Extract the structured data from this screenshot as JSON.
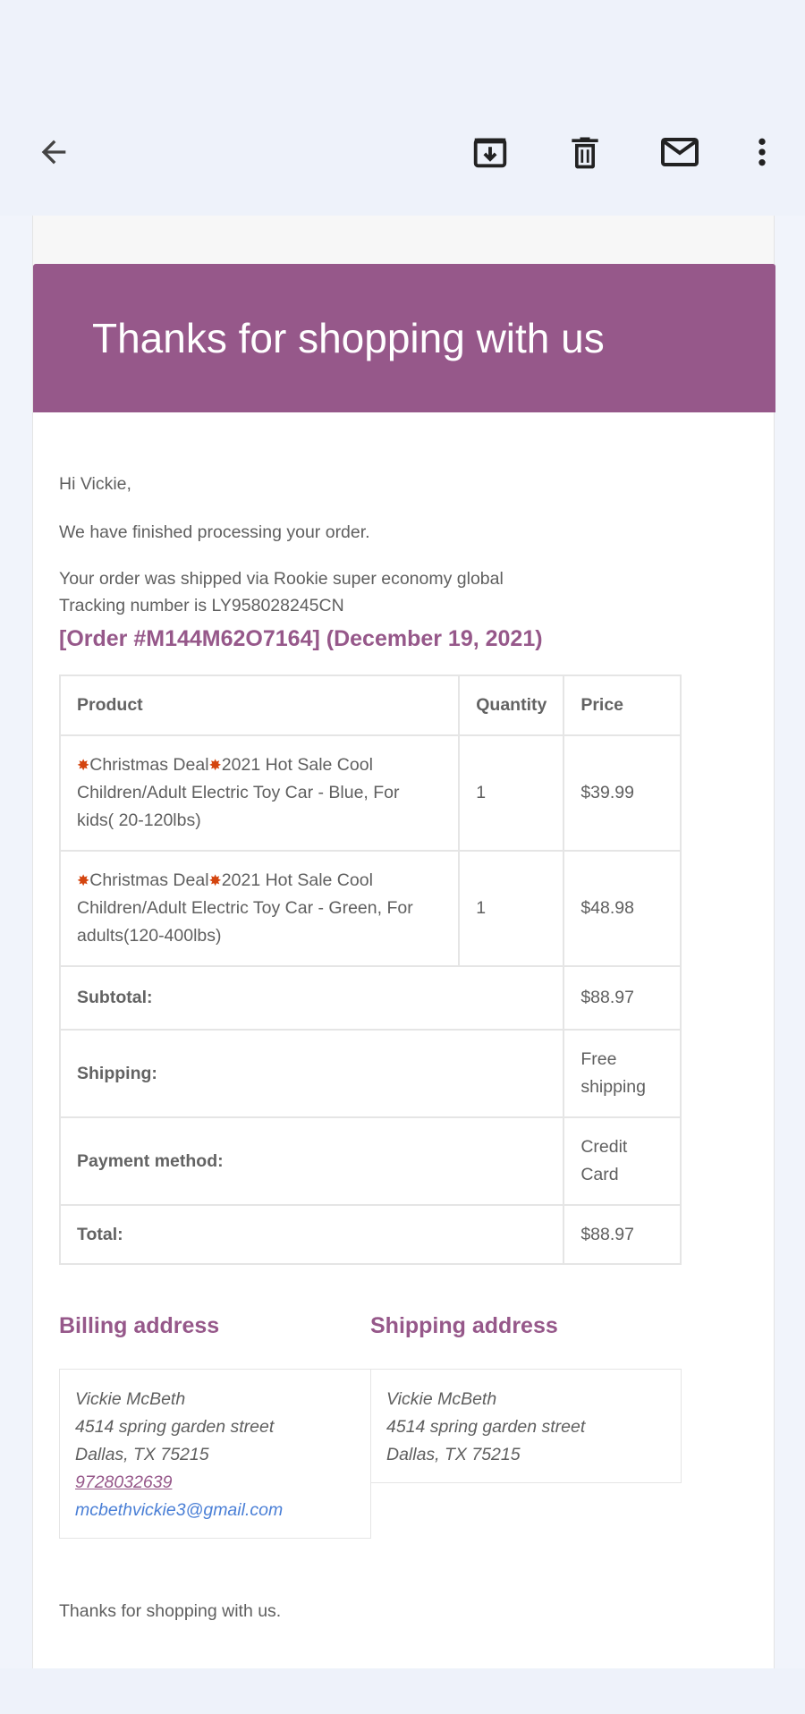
{
  "toolbar": {
    "back": "back-arrow",
    "archive": "archive-icon",
    "delete": "trash-icon",
    "mark_unread": "mail-icon",
    "more": "more-vert-icon"
  },
  "colors": {
    "brand": "#96588a",
    "link": "#4a7fd6",
    "appbar": "#eef2fa"
  },
  "email": {
    "banner_title": "Thanks for shopping with us",
    "greeting": "Hi Vickie,",
    "message": "We have finished processing your order.",
    "shipped_via": "Your order was shipped via Rookie super economy global",
    "tracking": "Tracking number is LY958028245CN",
    "order_heading": "[Order #M144M62O7164] (December 19, 2021)",
    "table": {
      "headers": [
        "Product",
        "Quantity",
        "Price"
      ],
      "items": [
        {
          "deal_label": "Christmas Deal",
          "name": "2021 Hot Sale Cool Children/Adult Electric Toy Car - Blue, For kids( 20-120lbs)",
          "name_line1": "2021 Hot Sale Cool",
          "name_line2": "Children/Adult Electric Toy Car - Blue, For",
          "name_line3": "kids( 20-120lbs)",
          "quantity": "1",
          "price": "$39.99"
        },
        {
          "deal_label": "Christmas Deal",
          "name": "2021 Hot Sale Cool Children/Adult Electric Toy Car - Green, For adults(120-400lbs)",
          "name_line1": "2021 Hot Sale Cool",
          "name_line2": "Children/Adult Electric Toy Car - Green, For",
          "name_line3": "adults(120-400lbs)",
          "quantity": "1",
          "price": "$48.98"
        }
      ],
      "totals": [
        {
          "label": "Subtotal:",
          "value": "$88.97"
        },
        {
          "label": "Shipping:",
          "value": "Free shipping",
          "value_line1": "Free",
          "value_line2": "shipping"
        },
        {
          "label": "Payment method:",
          "value": "Credit Card",
          "value_line1": "Credit",
          "value_line2": "Card"
        },
        {
          "label": "Total:",
          "value": "$88.97"
        }
      ]
    },
    "billing": {
      "heading": "Billing address",
      "name": "Vickie McBeth",
      "street": "4514 spring garden street",
      "city": "Dallas, TX 75215",
      "phone": "9728032639",
      "email": "mcbethvickie3@gmail.com"
    },
    "shipping": {
      "heading": "Shipping address",
      "name": "Vickie McBeth",
      "street": "4514 spring garden street",
      "city": "Dallas, TX 75215"
    },
    "closing": "Thanks for shopping with us."
  }
}
